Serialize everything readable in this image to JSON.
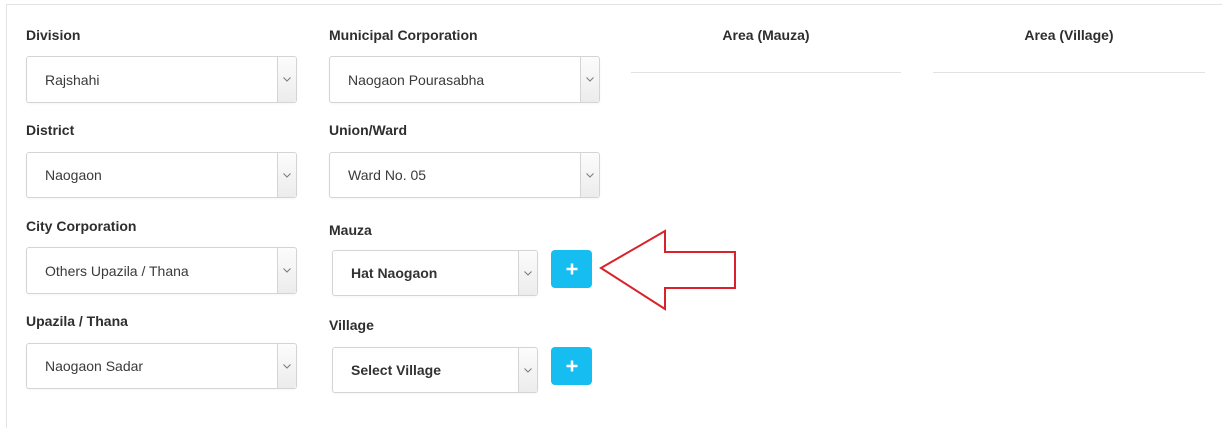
{
  "form": {
    "division": {
      "label": "Division",
      "value": "Rajshahi"
    },
    "district": {
      "label": "District",
      "value": "Naogaon"
    },
    "city_corporation": {
      "label": "City Corporation",
      "value": "Others Upazila / Thana"
    },
    "upazila": {
      "label": "Upazila / Thana",
      "value": "Naogaon Sadar"
    },
    "municipal_corporation": {
      "label": "Municipal Corporation",
      "value": "Naogaon Pourasabha"
    },
    "union_ward": {
      "label": "Union/Ward",
      "value": "Ward No. 05"
    },
    "mauza": {
      "label": "Mauza",
      "value": "Hat Naogaon",
      "add_label": "+"
    },
    "village": {
      "label": "Village",
      "value": "Select Village",
      "add_label": "+"
    }
  },
  "table": {
    "headers": [
      "Area (Mauza)",
      "Area (Village)"
    ]
  },
  "colors": {
    "accent": "#16bdf0",
    "annotation_arrow": "#d8232a"
  }
}
